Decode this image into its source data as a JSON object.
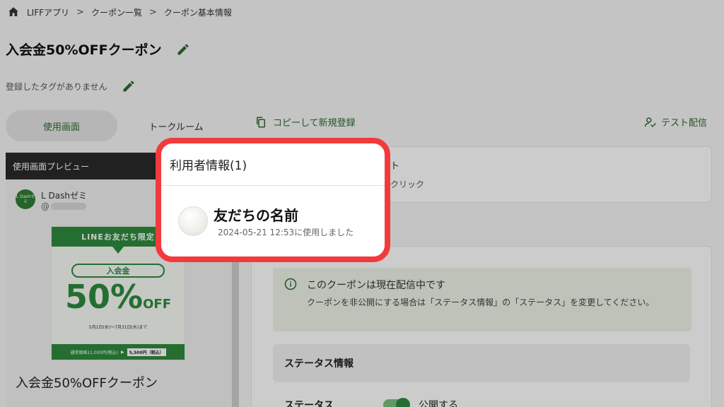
{
  "breadcrumb": {
    "items": [
      "LIFFアプリ",
      "クーポン一覧",
      "クーポン基本情報"
    ],
    "separator": ">"
  },
  "title": "入会金50%OFFクーポン",
  "tags": {
    "empty_text": "登録したタグがありません"
  },
  "tabs": [
    "使用画面",
    "トークルーム"
  ],
  "actions": {
    "copy_label": "コピーして新規登録",
    "test_label": "テスト配信"
  },
  "preview": {
    "header": "使用画面プレビュー",
    "account_name": "L Dashゼミ",
    "account_id_prefix": "@",
    "avatar_text": "L Dashゼミ",
    "coupon_image": {
      "banner": "LINEお友だち限定",
      "pill": "入会金",
      "big_number": "50%",
      "big_suffix": "OFF",
      "dates": "5月1日(水)〜7月31日(水)まで",
      "regular_price": "通常価格11,000円(税込)",
      "arrow": "▶",
      "sale_price": "5,500円（税込）"
    },
    "coupon_title": "入会金50%OFFクーポン"
  },
  "card1": {
    "line1": "ト",
    "line2": "クリック"
  },
  "status_notice": {
    "title": "このクーポンは現在配信中です",
    "body": "クーポンを非公開にする場合は「ステータス情報」の「ステータス」を変更してください。"
  },
  "status_section": {
    "title": "ステータス情報",
    "label": "ステータス",
    "value": "公開する",
    "enabled": true
  },
  "modal": {
    "title": "利用者情報(1)",
    "users": [
      {
        "name": "友だちの名前",
        "used_at": "2024-05-21 12:53に使用しました"
      }
    ]
  },
  "colors": {
    "accent": "#2f8a3e",
    "highlight_border": "#f23a3c"
  }
}
